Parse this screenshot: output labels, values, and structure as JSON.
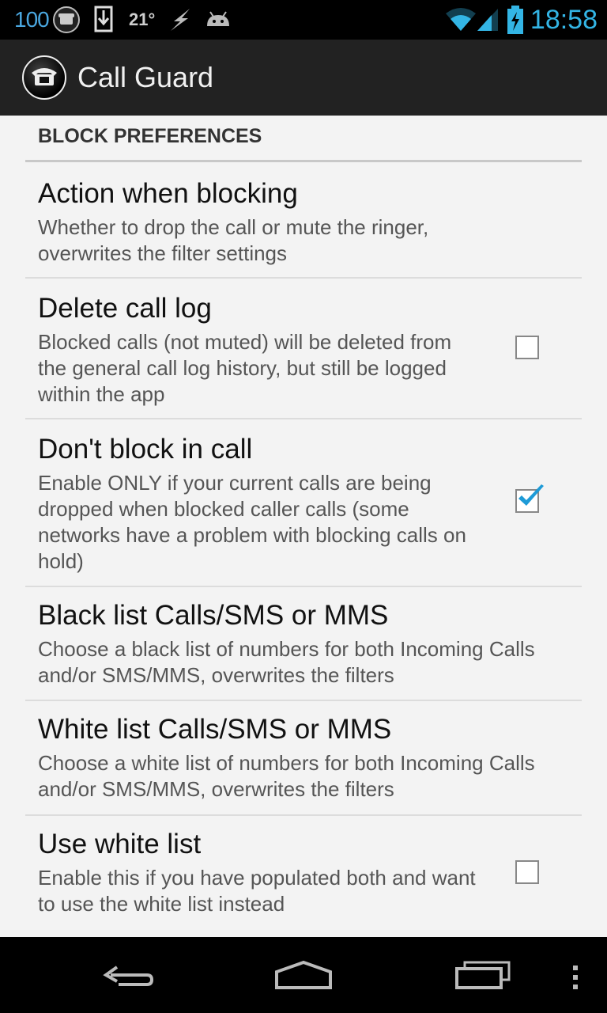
{
  "status_bar": {
    "battery_percent_text": "100",
    "temperature": "21°",
    "clock": "18:58",
    "icons": [
      "phone-icon",
      "download-icon",
      "weather-lightning-icon",
      "android-icon",
      "wifi-icon",
      "signal-icon",
      "battery-charging-icon"
    ]
  },
  "action_bar": {
    "title": "Call Guard",
    "icon": "app-phone-icon"
  },
  "section": {
    "header": "BLOCK PREFERENCES"
  },
  "preferences": [
    {
      "title": "Action when blocking",
      "summary": "Whether to drop the call or mute the ringer, overwrites the filter settings"
    },
    {
      "title": "Delete call log",
      "summary": "Blocked calls (not muted) will be deleted from the general call log history, but still be logged within the app",
      "checked": false
    },
    {
      "title": "Don't block in call",
      "summary": "Enable ONLY if your current calls are being dropped when blocked caller calls (some networks have a problem with blocking calls on hold)",
      "checked": true
    },
    {
      "title": "Black list Calls/SMS or MMS",
      "summary": "Choose a black list of numbers for both Incoming Calls and/or SMS/MMS, overwrites the filters"
    },
    {
      "title": "White list Calls/SMS or MMS",
      "summary": "Choose a white list of numbers for both Incoming Calls and/or SMS/MMS, overwrites the filters"
    },
    {
      "title": "Use white list",
      "summary": "Enable this if you have populated both and want to use the white list instead",
      "checked": false
    }
  ],
  "nav_bar": {
    "buttons": [
      "back-icon",
      "home-icon",
      "recents-icon",
      "overflow-menu-icon"
    ]
  },
  "colors": {
    "accent": "#33b5e5",
    "check": "#1e9bd7"
  }
}
